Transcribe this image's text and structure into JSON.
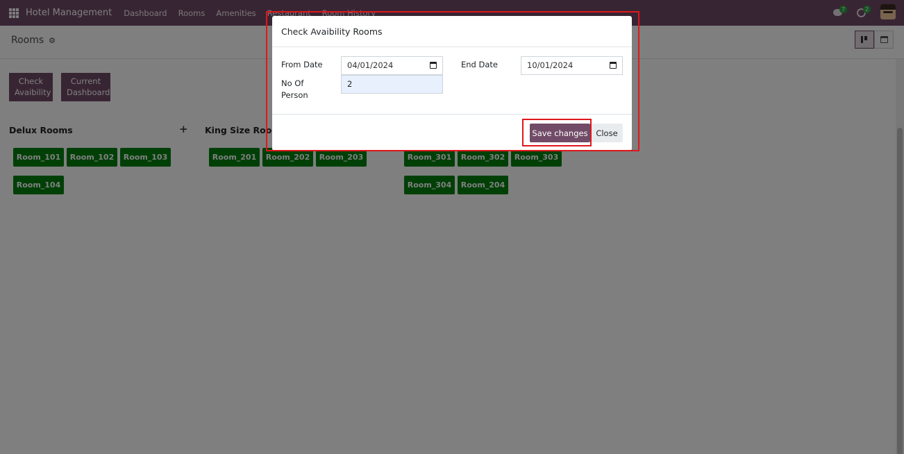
{
  "navbar": {
    "app_title": "Hotel Management",
    "menu": [
      "Dashboard",
      "Rooms",
      "Amenities",
      "Restaurant",
      "Room History"
    ],
    "messages_count": "7",
    "activities_count": "2",
    "icons": {
      "apps": "apps-grid-icon",
      "messages": "chat-icon",
      "activities": "clock-icon",
      "user": "user-avatar"
    }
  },
  "control_panel": {
    "breadcrumb": "Rooms",
    "gear_icon": "⚙",
    "views": [
      "kanban-view-icon",
      "calendar-view-icon"
    ]
  },
  "actions": {
    "check_availability": [
      "Check",
      "Avaibility"
    ],
    "current_dashboard": [
      "Current",
      "Dashboard"
    ]
  },
  "columns": [
    {
      "title": "Delux Rooms",
      "rooms": [
        "Room_101",
        "Room_102",
        "Room_103",
        "Room_104"
      ]
    },
    {
      "title": "King Size Rooms",
      "rooms": [
        "Room_201",
        "Room_202",
        "Room_203"
      ]
    },
    {
      "title": "",
      "rooms": [
        "Room_301",
        "Room_302",
        "Room_303",
        "Room_304",
        "Room_204"
      ]
    }
  ],
  "column_plus": "+",
  "modal": {
    "title": "Check Avaibility Rooms",
    "from_date_label": "From Date",
    "from_date_value": "04/01/2024",
    "end_date_label": "End Date",
    "end_date_value": "10/01/2024",
    "persons_label": [
      "No Of",
      "Person"
    ],
    "persons_value": "2",
    "save_label": "Save changes",
    "close_label": "Close"
  },
  "colors": {
    "brand": "#714b67",
    "room_button": "#00800e",
    "annotation": "#e0161d"
  }
}
